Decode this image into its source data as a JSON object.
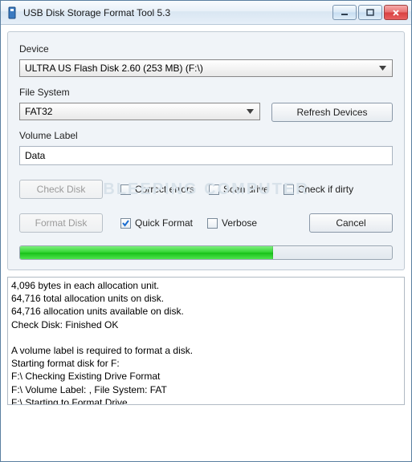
{
  "window": {
    "title": "USB Disk Storage Format Tool 5.3"
  },
  "labels": {
    "device": "Device",
    "file_system": "File System",
    "volume_label": "Volume Label"
  },
  "device": {
    "selected": "ULTRA US  Flash Disk  2.60 (253 MB) (F:\\)"
  },
  "file_system": {
    "selected": "FAT32"
  },
  "volume_label": {
    "value": "Data"
  },
  "buttons": {
    "refresh": "Refresh Devices",
    "check_disk": "Check Disk",
    "format_disk": "Format Disk",
    "cancel": "Cancel"
  },
  "check_options": {
    "correct_errors": {
      "label": "Correct errors",
      "checked": false
    },
    "scan_drive": {
      "label": "Scan drive",
      "checked": false
    },
    "check_if_dirty": {
      "label": "Check if dirty",
      "checked": false
    }
  },
  "format_options": {
    "quick_format": {
      "label": "Quick Format",
      "checked": true
    },
    "verbose": {
      "label": "Verbose",
      "checked": false
    }
  },
  "progress": {
    "percent": 68
  },
  "log": "4,096 bytes in each allocation unit.\n64,716 total allocation units on disk.\n64,716 allocation units available on disk.\nCheck Disk: Finished OK\n\nA volume label is required to format a disk.\nStarting format disk for F:\nF:\\ Checking Existing Drive Format\nF:\\ Volume Label: , File System: FAT\nF:\\ Starting to Format Drive"
}
